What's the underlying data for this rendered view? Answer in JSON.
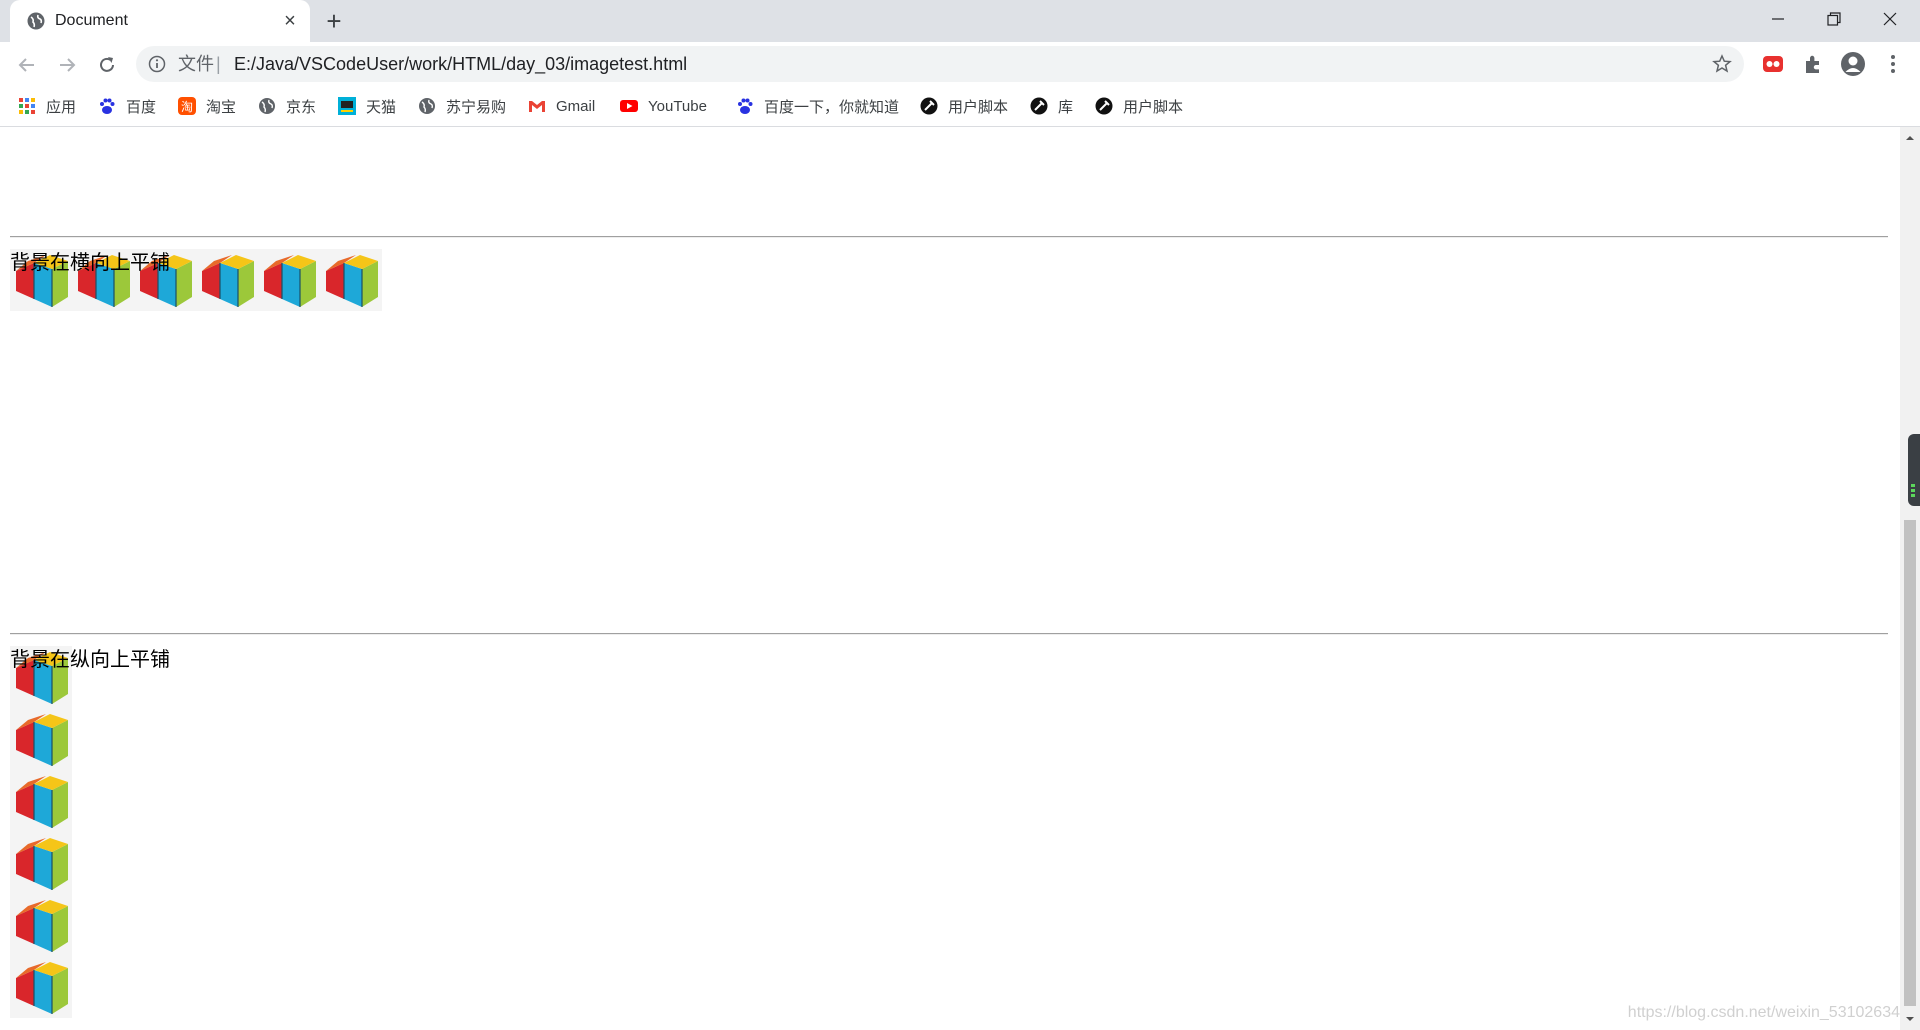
{
  "tab": {
    "title": "Document"
  },
  "omnibox": {
    "scheme_label": "文件",
    "separator": "|",
    "url": "E:/Java/VSCodeUser/work/HTML/day_03/imagetest.html"
  },
  "bookmarks": [
    {
      "label": "应用",
      "icon": "apps-grid-icon"
    },
    {
      "label": "百度",
      "icon": "baidu-paw-icon"
    },
    {
      "label": "淘宝",
      "icon": "taobao-icon"
    },
    {
      "label": "京东",
      "icon": "globe-icon"
    },
    {
      "label": "天猫",
      "icon": "tmall-icon"
    },
    {
      "label": "苏宁易购",
      "icon": "globe-icon"
    },
    {
      "label": "Gmail",
      "icon": "gmail-icon"
    },
    {
      "label": "YouTube",
      "icon": "youtube-icon"
    },
    {
      "label": "百度一下，你就知道",
      "icon": "baidu-paw-icon"
    },
    {
      "label": "用户脚本",
      "icon": "userscript-icon"
    },
    {
      "label": "库",
      "icon": "userscript-icon"
    },
    {
      "label": "用户脚本",
      "icon": "userscript-icon"
    }
  ],
  "page": {
    "horizontal_label": "背景在横向上平铺",
    "vertical_label": "背景在纵向上平铺",
    "horizontal_tile_count": 6,
    "vertical_tile_count": 6
  },
  "watermark": "https://blog.csdn.net/weixin_53102634",
  "colors": {
    "tabstrip": "#dee1e6",
    "omnibox": "#f1f3f4",
    "cube_red": "#d9262b",
    "cube_blue": "#1ea8d8",
    "cube_green": "#9cc83a",
    "cube_yellow": "#f5c518"
  }
}
